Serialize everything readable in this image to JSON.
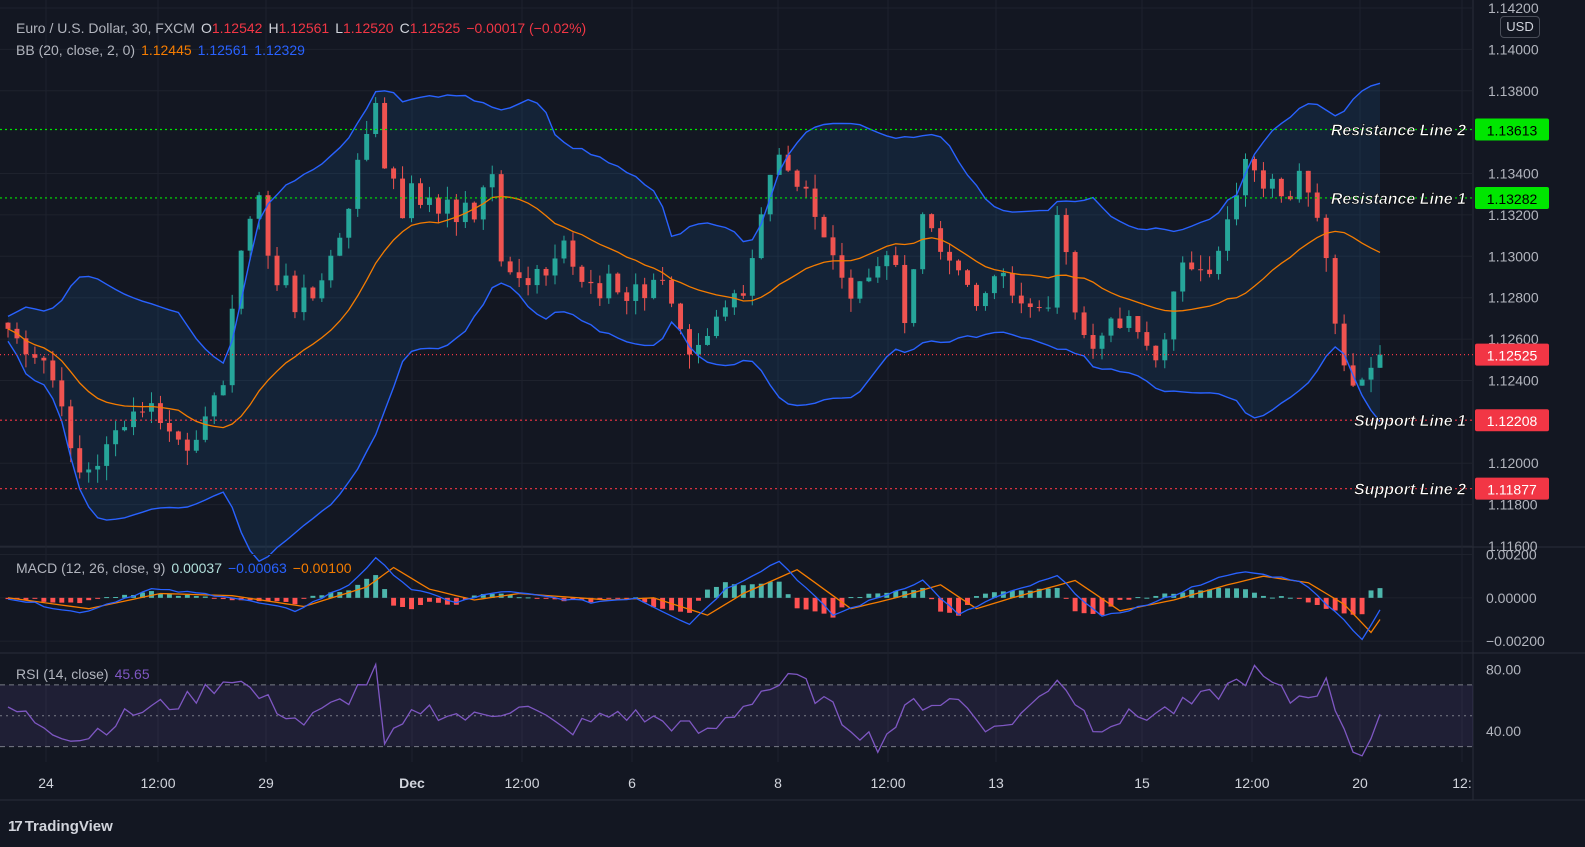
{
  "header": {
    "symbol": "Euro / U.S. Dollar, 30, FXCM",
    "o_label": "O",
    "o_value": "1.12542",
    "h_label": "H",
    "h_value": "1.12561",
    "l_label": "L",
    "l_value": "1.12520",
    "c_label": "C",
    "c_value": "1.12525",
    "change": "−0.00017 (−0.02%)"
  },
  "bb_legend": {
    "label": "BB (20, close, 2, 0)",
    "basis": "1.12445",
    "upper": "1.12561",
    "lower": "1.12329"
  },
  "macd_legend": {
    "label": "MACD (12, 26, close, 9)",
    "hist": "0.00037",
    "macd": "−0.00063",
    "signal": "−0.00100"
  },
  "rsi_legend": {
    "label": "RSI (14, close)",
    "value": "45.65"
  },
  "currency": "USD",
  "branding": "TradingView",
  "colors": {
    "background": "#131722",
    "up": "#26a69a",
    "down": "#ef5350",
    "bb_band": "#2962ff",
    "bb_basis": "#f57c00",
    "rsi": "#7e57c2",
    "resistance": "#00e600",
    "support": "#f23645",
    "last_price": "#f23645"
  },
  "chart_data": [
    {
      "type": "candlestick",
      "ylim": [
        1.116,
        1.142
      ],
      "y_ticks": [
        "1.14200",
        "1.14000",
        "1.13800",
        "1.13400",
        "1.13200",
        "1.13000",
        "1.12800",
        "1.12600",
        "1.12400",
        "1.12000",
        "1.11800",
        "1.11600"
      ],
      "x_ticks": [
        "24",
        "12:00",
        "29",
        "Dec",
        "12:00",
        "6",
        "8",
        "12:00",
        "13",
        "15",
        "12:00",
        "20",
        "12:"
      ],
      "close_path": [
        [
          0,
          1.1265
        ],
        [
          2,
          1.1255
        ],
        [
          4,
          1.125
        ],
        [
          6,
          1.123
        ],
        [
          7,
          1.1205
        ],
        [
          8,
          1.1195
        ],
        [
          10,
          1.12
        ],
        [
          12,
          1.1215
        ],
        [
          14,
          1.1225
        ],
        [
          16,
          1.1228
        ],
        [
          18,
          1.1215
        ],
        [
          20,
          1.1208
        ],
        [
          22,
          1.122
        ],
        [
          24,
          1.124
        ],
        [
          25,
          1.1275
        ],
        [
          26,
          1.13
        ],
        [
          27,
          1.132
        ],
        [
          28,
          1.133
        ],
        [
          29,
          1.13
        ],
        [
          30,
          1.1285
        ],
        [
          31,
          1.1292
        ],
        [
          32,
          1.1275
        ],
        [
          33,
          1.1282
        ],
        [
          34,
          1.128
        ],
        [
          35,
          1.129
        ],
        [
          36,
          1.13
        ],
        [
          37,
          1.131
        ],
        [
          38,
          1.1325
        ],
        [
          39,
          1.1345
        ],
        [
          40,
          1.136
        ],
        [
          41,
          1.1375
        ],
        [
          42,
          1.1345
        ],
        [
          43,
          1.1335
        ],
        [
          44,
          1.132
        ],
        [
          45,
          1.1333
        ],
        [
          46,
          1.1325
        ],
        [
          47,
          1.133
        ],
        [
          48,
          1.132
        ],
        [
          49,
          1.1328
        ],
        [
          50,
          1.1315
        ],
        [
          51,
          1.1325
        ],
        [
          52,
          1.132
        ],
        [
          53,
          1.1335
        ],
        [
          54,
          1.134
        ],
        [
          55,
          1.13
        ],
        [
          56,
          1.1295
        ],
        [
          57,
          1.129
        ],
        [
          58,
          1.1285
        ],
        [
          59,
          1.1293
        ],
        [
          60,
          1.1288
        ],
        [
          61,
          1.13
        ],
        [
          62,
          1.1308
        ],
        [
          63,
          1.1295
        ],
        [
          64,
          1.1288
        ],
        [
          65,
          1.1285
        ],
        [
          66,
          1.128
        ],
        [
          67,
          1.1292
        ],
        [
          68,
          1.1284
        ],
        [
          69,
          1.128
        ],
        [
          70,
          1.1285
        ],
        [
          71,
          1.1282
        ],
        [
          72,
          1.129
        ],
        [
          73,
          1.1287
        ],
        [
          74,
          1.1275
        ],
        [
          75,
          1.1262
        ],
        [
          76,
          1.125
        ],
        [
          77,
          1.1255
        ],
        [
          78,
          1.126
        ],
        [
          79,
          1.127
        ],
        [
          80,
          1.1275
        ],
        [
          81,
          1.1285
        ],
        [
          82,
          1.1282
        ],
        [
          83,
          1.13
        ],
        [
          84,
          1.1322
        ],
        [
          85,
          1.134
        ],
        [
          86,
          1.1348
        ],
        [
          87,
          1.134
        ],
        [
          88,
          1.1335
        ],
        [
          89,
          1.133
        ],
        [
          90,
          1.1322
        ],
        [
          91,
          1.131
        ],
        [
          92,
          1.13
        ],
        [
          93,
          1.129
        ],
        [
          94,
          1.1282
        ],
        [
          95,
          1.1285
        ],
        [
          96,
          1.129
        ],
        [
          97,
          1.1293
        ],
        [
          98,
          1.13
        ],
        [
          99,
          1.1296
        ],
        [
          100,
          1.127
        ],
        [
          101,
          1.1292
        ],
        [
          102,
          1.1318
        ],
        [
          103,
          1.1315
        ],
        [
          104,
          1.1305
        ],
        [
          105,
          1.13
        ],
        [
          106,
          1.1292
        ],
        [
          107,
          1.1285
        ],
        [
          108,
          1.1275
        ],
        [
          109,
          1.128
        ],
        [
          110,
          1.1292
        ],
        [
          111,
          1.129
        ],
        [
          112,
          1.1283
        ],
        [
          113,
          1.128
        ],
        [
          114,
          1.1278
        ],
        [
          115,
          1.1278
        ],
        [
          116,
          1.1275
        ],
        [
          117,
          1.1318
        ],
        [
          118,
          1.13
        ],
        [
          119,
          1.1275
        ],
        [
          120,
          1.1262
        ],
        [
          121,
          1.1258
        ],
        [
          122,
          1.1263
        ],
        [
          123,
          1.127
        ],
        [
          124,
          1.1268
        ],
        [
          125,
          1.1272
        ],
        [
          126,
          1.1265
        ],
        [
          127,
          1.1258
        ],
        [
          128,
          1.1248
        ],
        [
          129,
          1.1262
        ],
        [
          130,
          1.1285
        ],
        [
          131,
          1.13
        ],
        [
          132,
          1.1293
        ],
        [
          133,
          1.1296
        ],
        [
          134,
          1.1292
        ],
        [
          135,
          1.1305
        ],
        [
          136,
          1.1318
        ],
        [
          137,
          1.133
        ],
        [
          138,
          1.135
        ],
        [
          139,
          1.134
        ],
        [
          140,
          1.1333
        ],
        [
          141,
          1.1336
        ],
        [
          142,
          1.133
        ],
        [
          143,
          1.1325
        ],
        [
          144,
          1.134
        ],
        [
          145,
          1.133
        ],
        [
          146,
          1.132
        ],
        [
          147,
          1.13
        ],
        [
          148,
          1.127
        ],
        [
          149,
          1.1245
        ],
        [
          150,
          1.124
        ],
        [
          151,
          1.1243
        ],
        [
          152,
          1.1248
        ],
        [
          153,
          1.12525
        ]
      ],
      "levels": [
        {
          "name": "Resistance Line 2",
          "price": "1.13613",
          "value": 1.13613,
          "style": "resistance"
        },
        {
          "name": "Resistance Line 1",
          "price": "1.13282",
          "value": 1.13282,
          "style": "resistance"
        },
        {
          "name": "",
          "price": "1.12525",
          "value": 1.12525,
          "style": "last"
        },
        {
          "name": "Support Line 1",
          "price": "1.12208",
          "value": 1.12208,
          "style": "support"
        },
        {
          "name": "Support Line 2",
          "price": "1.11877",
          "value": 1.11877,
          "style": "support"
        }
      ]
    },
    {
      "type": "macd",
      "ylim": [
        -0.0025,
        0.0023
      ],
      "y_ticks": [
        "0.00200",
        "0.00000",
        "−0.00200"
      ],
      "y_tick_values": [
        0.002,
        0.0,
        -0.002
      ],
      "macd_path": [
        [
          0,
          0.0
        ],
        [
          8,
          -0.0007
        ],
        [
          16,
          0.0004
        ],
        [
          24,
          0.0001
        ],
        [
          32,
          -0.0006
        ],
        [
          38,
          0.0006
        ],
        [
          41,
          0.0018
        ],
        [
          45,
          0.0004
        ],
        [
          50,
          -0.0002
        ],
        [
          55,
          0.0003
        ],
        [
          65,
          -0.0002
        ],
        [
          70,
          0.0
        ],
        [
          76,
          -0.0012
        ],
        [
          80,
          0.0004
        ],
        [
          86,
          0.0017
        ],
        [
          92,
          -0.0008
        ],
        [
          97,
          0.0
        ],
        [
          102,
          0.0008
        ],
        [
          106,
          -0.0008
        ],
        [
          110,
          0.0
        ],
        [
          117,
          0.001
        ],
        [
          122,
          -0.0009
        ],
        [
          128,
          -0.0002
        ],
        [
          134,
          0.0008
        ],
        [
          138,
          0.0012
        ],
        [
          144,
          0.0008
        ],
        [
          148,
          -0.0006
        ],
        [
          151,
          -0.0019
        ],
        [
          153,
          -0.0006
        ]
      ],
      "signal_path": [
        [
          0,
          0.0
        ],
        [
          9,
          -0.0005
        ],
        [
          17,
          0.0002
        ],
        [
          25,
          0.0001
        ],
        [
          33,
          -0.0004
        ],
        [
          40,
          0.0005
        ],
        [
          43,
          0.0014
        ],
        [
          47,
          0.0004
        ],
        [
          52,
          -0.0001
        ],
        [
          57,
          0.0002
        ],
        [
          67,
          -0.0001
        ],
        [
          72,
          0.0
        ],
        [
          78,
          -0.0008
        ],
        [
          82,
          0.0002
        ],
        [
          88,
          0.0013
        ],
        [
          94,
          -0.0005
        ],
        [
          99,
          0.0
        ],
        [
          104,
          0.0006
        ],
        [
          108,
          -0.0005
        ],
        [
          112,
          0.0
        ],
        [
          119,
          0.0008
        ],
        [
          124,
          -0.0006
        ],
        [
          130,
          -0.0001
        ],
        [
          136,
          0.0006
        ],
        [
          140,
          0.001
        ],
        [
          145,
          0.0007
        ],
        [
          149,
          -0.0003
        ],
        [
          152,
          -0.0016
        ],
        [
          153,
          -0.001
        ]
      ]
    },
    {
      "type": "rsi",
      "ylim": [
        20,
        90
      ],
      "y_ticks": [
        "80.00",
        "40.00"
      ],
      "y_tick_values": [
        80,
        40
      ],
      "band": [
        30,
        70
      ],
      "rsi_path": [
        [
          0,
          55
        ],
        [
          5,
          42
        ],
        [
          8,
          35
        ],
        [
          14,
          52
        ],
        [
          20,
          60
        ],
        [
          25,
          76
        ],
        [
          28,
          62
        ],
        [
          33,
          45
        ],
        [
          38,
          62
        ],
        [
          41,
          78
        ],
        [
          42,
          30
        ],
        [
          46,
          55
        ],
        [
          52,
          48
        ],
        [
          57,
          58
        ],
        [
          62,
          40
        ],
        [
          68,
          52
        ],
        [
          74,
          45
        ],
        [
          78,
          38
        ],
        [
          84,
          66
        ],
        [
          88,
          74
        ],
        [
          93,
          48
        ],
        [
          97,
          32
        ],
        [
          101,
          58
        ],
        [
          106,
          60
        ],
        [
          110,
          40
        ],
        [
          114,
          55
        ],
        [
          117,
          76
        ],
        [
          121,
          44
        ],
        [
          126,
          50
        ],
        [
          130,
          54
        ],
        [
          134,
          62
        ],
        [
          139,
          78
        ],
        [
          143,
          60
        ],
        [
          147,
          70
        ],
        [
          150,
          30
        ],
        [
          151,
          24
        ],
        [
          153,
          46
        ]
      ]
    }
  ]
}
